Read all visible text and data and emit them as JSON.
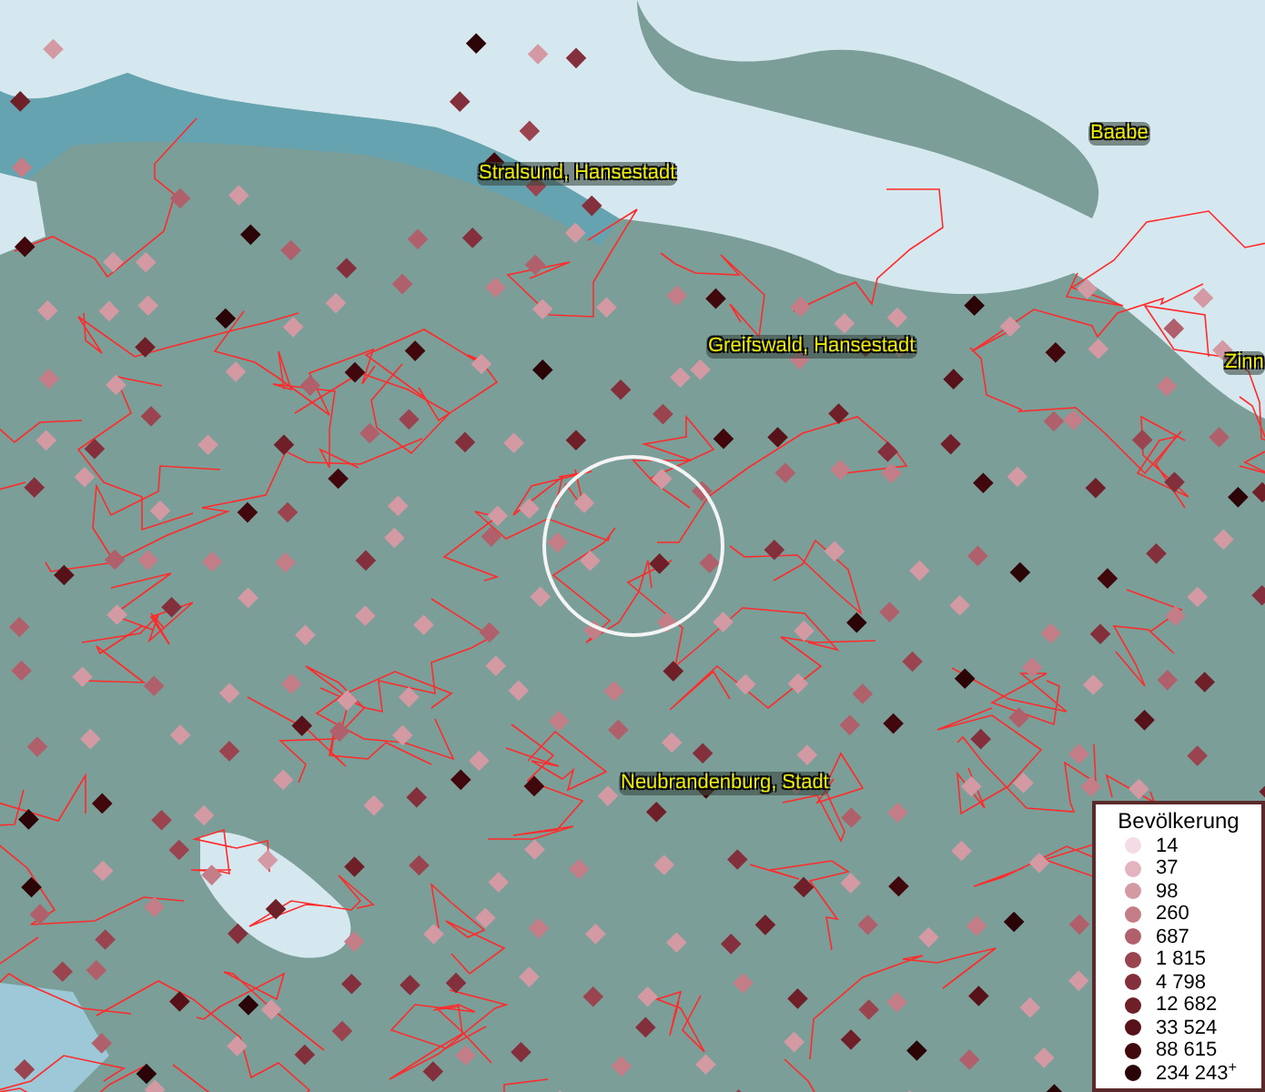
{
  "map_labels": [
    {
      "text": "Stralsund, Hansestadt"
    },
    {
      "text": "Greifswald, Hansestadt"
    },
    {
      "text": "Baabe"
    },
    {
      "text": "Zinn"
    },
    {
      "text": "Neubrandenburg, Stadt"
    }
  ],
  "legend": {
    "title": "Bevölkerung",
    "items": [
      {
        "label": "14",
        "color": "#f5dbe6"
      },
      {
        "label": "37",
        "color": "#e3b4c0"
      },
      {
        "label": "98",
        "color": "#d49aa4"
      },
      {
        "label": "260",
        "color": "#c47e88"
      },
      {
        "label": "687",
        "color": "#b0606b"
      },
      {
        "label": "1 815",
        "color": "#9a4450"
      },
      {
        "label": "4 798",
        "color": "#84303c"
      },
      {
        "label": "12 682",
        "color": "#6e1f28"
      },
      {
        "label": "33 524",
        "color": "#561218"
      },
      {
        "label": "88 615",
        "color": "#40080c"
      },
      {
        "label": "234 243$^{+}$",
        "color": "#2a0406"
      }
    ]
  }
}
